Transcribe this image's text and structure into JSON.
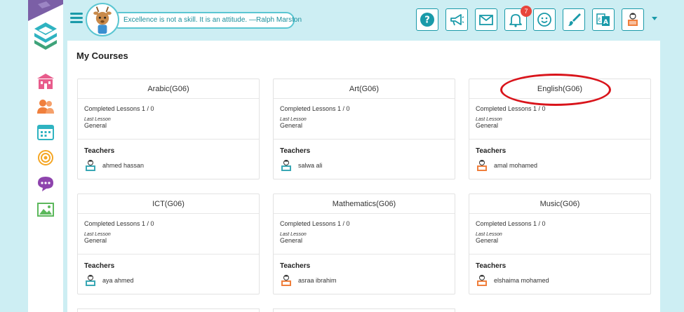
{
  "header": {
    "quote": "Excellence is not a skill. It is an attitude. —Ralph Marston",
    "notification_count": "7",
    "buttons": [
      "help-icon",
      "megaphone-icon",
      "envelope-icon",
      "bell-icon",
      "smiley-icon",
      "paintbrush-icon",
      "translate-icon",
      "user-avatar-icon"
    ]
  },
  "sidebar": {
    "items": [
      "school-icon",
      "users-icon",
      "calendar-icon",
      "target-icon",
      "chat-icon",
      "gallery-icon"
    ]
  },
  "main": {
    "title": "My Courses",
    "completed_label": "Completed Lessons 1 / 0",
    "last_lesson_label": "Last Lesson",
    "teachers_label": "Teachers",
    "courses": [
      {
        "name": "Arabic(G06)",
        "last_lesson": "General",
        "teacher": "ahmed hassan"
      },
      {
        "name": "Art(G06)",
        "last_lesson": "General",
        "teacher": "salwa ali"
      },
      {
        "name": "English(G06)",
        "last_lesson": "General",
        "teacher": "amal mohamed"
      },
      {
        "name": "ICT(G06)",
        "last_lesson": "General",
        "teacher": "aya ahmed"
      },
      {
        "name": "Mathematics(G06)",
        "last_lesson": "General",
        "teacher": "asraa ibrahim"
      },
      {
        "name": "Music(G06)",
        "last_lesson": "General",
        "teacher": "elshaima mohamed"
      }
    ]
  },
  "colors": {
    "accent": "#1a9aa9",
    "sidebar_icon": "#4cbfc9",
    "sidebar_home": "#e85c8c",
    "sidebar_users": "#f07f3c",
    "sidebar_target": "#f5a623",
    "sidebar_chat": "#8e44ad",
    "sidebar_gallery": "#5cb85c",
    "badge": "#e8453c",
    "highlight": "#d9141b",
    "background": "#cdeef3"
  }
}
